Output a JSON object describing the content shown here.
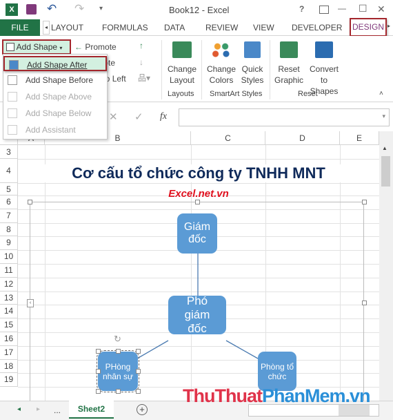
{
  "window": {
    "title": "Book12 - Excel",
    "help": "?",
    "minimize": "—",
    "maximize": "☐",
    "close": "✕"
  },
  "tabs": [
    {
      "label": "FILE"
    },
    {
      "label": "LAYOUT"
    },
    {
      "label": "FORMULAS"
    },
    {
      "label": "DATA"
    },
    {
      "label": "REVIEW"
    },
    {
      "label": "VIEW"
    },
    {
      "label": "DEVELOPER"
    },
    {
      "label": "DESIGN"
    }
  ],
  "ribbon": {
    "add_shape": "Add Shape",
    "promote": "Promote",
    "demote": "Demote",
    "right_to_left": "Right to Left",
    "change_layout": [
      "Change",
      "Layout"
    ],
    "change_colors": [
      "Change",
      "Colors"
    ],
    "quick_styles": [
      "Quick",
      "Styles"
    ],
    "reset_graphic": [
      "Reset",
      "Graphic"
    ],
    "convert": [
      "Convert",
      "to Shapes"
    ],
    "groups": {
      "layouts": "Layouts",
      "smartart_styles": "SmartArt Styles",
      "reset": "Reset"
    }
  },
  "menu": [
    {
      "label": "Add Shape After",
      "enabled": true,
      "highlighted": true
    },
    {
      "label": "Add Shape Before",
      "enabled": true
    },
    {
      "label": "Add Shape Above",
      "enabled": false
    },
    {
      "label": "Add Shape Below",
      "enabled": false
    },
    {
      "label": "Add Assistant",
      "enabled": false
    }
  ],
  "formula_bar": {
    "cancel": "✕",
    "enter": "✓",
    "fx": "fx",
    "value": ""
  },
  "columns": [
    "A",
    "B",
    "C",
    "D",
    "E"
  ],
  "rows": [
    "3",
    "4",
    "5",
    "6",
    "7",
    "8",
    "9",
    "10",
    "11",
    "12",
    "13",
    "14",
    "15",
    "16",
    "17",
    "18",
    "19"
  ],
  "sheet": {
    "title": "Cơ cấu tổ chức công ty TNHH MNT",
    "subtitle": "Excel.net.vn"
  },
  "smartart": {
    "top": "Giám đốc",
    "middle": "Phó giám đốc",
    "left": "PHòng nhân sự",
    "right": "Phòng tổ chức",
    "fill": "#5b9bd5"
  },
  "sheets": {
    "ellipsis": "...",
    "active": "Sheet2",
    "add": "+"
  },
  "watermark": {
    "part1": "ThuThuat",
    "part2": "PhanMem.vn"
  },
  "colors": {
    "file_tab": "#217346",
    "highlight_border": "#a4262c",
    "title_text": "#0f2a5a",
    "subtitle": "#e0101e"
  }
}
